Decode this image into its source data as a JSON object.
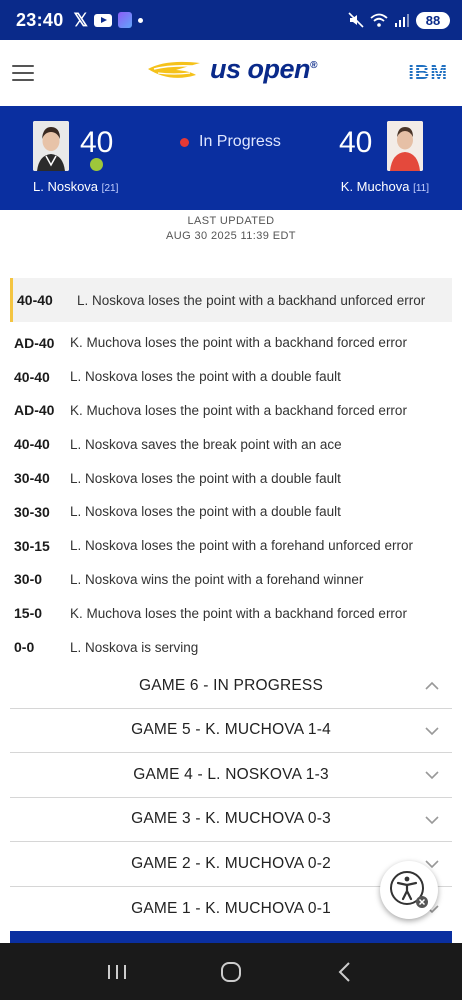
{
  "status_bar": {
    "time": "23:40",
    "x_icon_text": "𝕏",
    "battery": "88",
    "icons": [
      "x-icon",
      "youtube-icon",
      "app-icon",
      "dot-icon",
      "mute-icon",
      "wifi-icon",
      "signal-icon",
      "battery-icon"
    ]
  },
  "header": {
    "logo_text": "us open",
    "logo_mark": "®",
    "sponsor": "IBM",
    "menu_icon": "hamburger-menu-icon"
  },
  "match": {
    "status": "In Progress",
    "status_color": "#e53935",
    "player1": {
      "name": "L. Noskova",
      "seed": "[21]",
      "score": "40",
      "serving": true
    },
    "player2": {
      "name": "K. Muchova",
      "seed": "[11]",
      "score": "40",
      "serving": false
    }
  },
  "last_updated": {
    "label": "LAST UPDATED",
    "value": "AUG 30 2025 11:39 EDT"
  },
  "points": [
    {
      "score": "40-40",
      "text": "L. Noskova loses the point with a backhand unforced error",
      "highlight": true
    },
    {
      "score": "AD-40",
      "text": "K. Muchova loses the point with a backhand forced error"
    },
    {
      "score": "40-40",
      "text": "L. Noskova loses the point with a double fault"
    },
    {
      "score": "AD-40",
      "text": "K. Muchova loses the point with a backhand forced error"
    },
    {
      "score": "40-40",
      "text": "L. Noskova saves the break point with an ace"
    },
    {
      "score": "30-40",
      "text": "L. Noskova loses the point with a double fault"
    },
    {
      "score": "30-30",
      "text": "L. Noskova loses the point with a double fault"
    },
    {
      "score": "30-15",
      "text": "L. Noskova loses the point with a forehand unforced error"
    },
    {
      "score": "30-0",
      "text": "L. Noskova wins the point with a forehand winner"
    },
    {
      "score": "15-0",
      "text": "K. Muchova loses the point with a backhand forced error"
    },
    {
      "score": "0-0",
      "text": "L. Noskova is serving"
    }
  ],
  "games": [
    {
      "label": "GAME 6 - IN PROGRESS",
      "expanded": true
    },
    {
      "label": "GAME 5 - K. MUCHOVA 1-4",
      "expanded": false
    },
    {
      "label": "GAME 4 - L. NOSKOVA 1-3",
      "expanded": false
    },
    {
      "label": "GAME 3 - K. MUCHOVA 0-3",
      "expanded": false
    },
    {
      "label": "GAME 2 - K. MUCHOVA 0-2",
      "expanded": false
    },
    {
      "label": "GAME 1 - K. MUCHOVA 0-1",
      "expanded": false
    }
  ],
  "colors": {
    "brand_blue": "#0a2fa0",
    "highlight_bar": "#f4c542",
    "serve_ball": "#9ec73a"
  }
}
